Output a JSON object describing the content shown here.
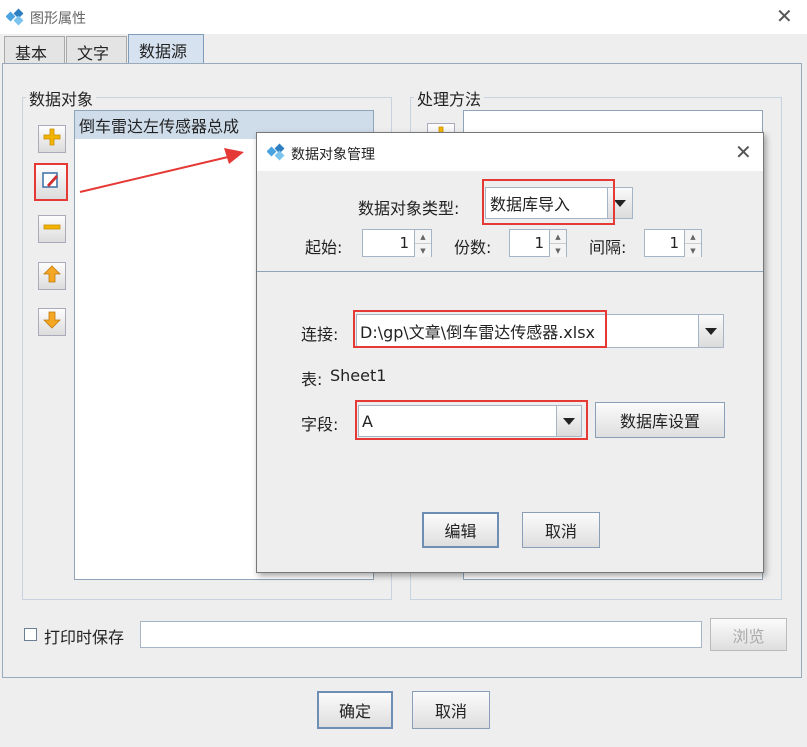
{
  "window": {
    "title": "图形属性"
  },
  "tabs": [
    {
      "label": "基本"
    },
    {
      "label": "文字"
    },
    {
      "label": "数据源",
      "active": true
    }
  ],
  "data_objects": {
    "title": "数据对象",
    "items": [
      "倒车雷达左传感器总成"
    ]
  },
  "processing": {
    "title": "处理方法"
  },
  "print_save": {
    "label": "打印时保存",
    "checked": false,
    "browse_label": "浏览"
  },
  "footer": {
    "ok_label": "确定",
    "cancel_label": "取消"
  },
  "dialog": {
    "title": "数据对象管理",
    "type_label": "数据对象类型:",
    "type_value": "数据库导入",
    "start_label": "起始:",
    "start_value": "1",
    "copies_label": "份数:",
    "copies_value": "1",
    "interval_label": "间隔:",
    "interval_value": "1",
    "connection_label": "连接:",
    "connection_value": "D:\\gp\\文章\\倒车雷达传感器.xlsx",
    "table_label": "表:",
    "table_value": "Sheet1",
    "field_label": "字段:",
    "field_value": "A",
    "db_settings_label": "数据库设置",
    "edit_label": "编辑",
    "cancel_label": "取消"
  },
  "colors": {
    "highlight_red": "#e53935",
    "selection_bg": "#cfdcea",
    "icon_plus": "#f2b400",
    "icon_arrow": "#f5a623"
  }
}
